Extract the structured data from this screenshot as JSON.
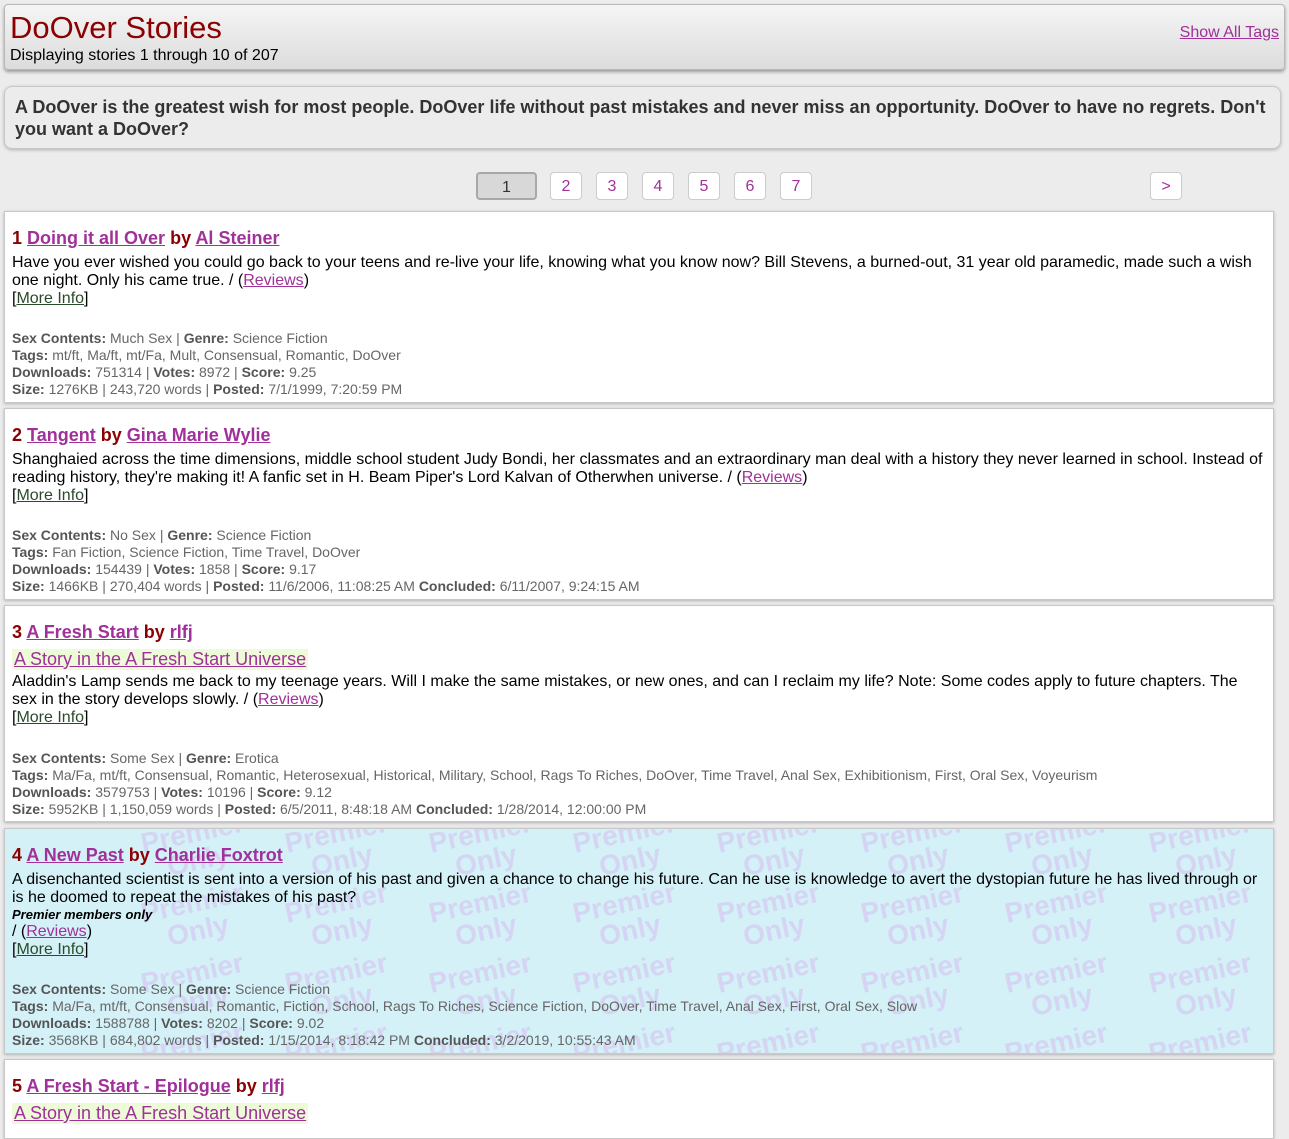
{
  "header": {
    "title": "DoOver Stories",
    "subtitle": "Displaying stories 1 through 10 of 207",
    "show_all_tags": "Show All Tags"
  },
  "intro": "A DoOver is the greatest wish for most people. DoOver life without past mistakes and never miss an opportunity. DoOver to have no regrets. Don't you want a DoOver?",
  "pager": {
    "current": "1",
    "pages": [
      "2",
      "3",
      "4",
      "5",
      "6",
      "7"
    ],
    "next": ">"
  },
  "labels": {
    "by": "by",
    "reviews": "Reviews",
    "more_info": "More Info",
    "sex_contents": "Sex Contents:",
    "genre": "Genre:",
    "tags": "Tags:",
    "downloads": "Downloads:",
    "votes": "Votes:",
    "score": "Score:",
    "size": "Size:",
    "posted": "Posted:",
    "concluded": "Concluded:",
    "premier_only": "Premier members only",
    "watermark_1": "Premier",
    "watermark_2": "Only"
  },
  "stories": [
    {
      "num": "1",
      "title": "Doing it all Over",
      "author": "Al Steiner",
      "desc": "Have you ever wished you could go back to your teens and re-live your life, knowing what you know now? Bill Stevens, a burned-out, 31 year old paramedic, made such a wish one night. Only his came true. / (",
      "sex": "Much Sex",
      "genre": "Science Fiction",
      "tags": "mt/ft, Ma/ft, mt/Fa, Mult, Consensual, Romantic, DoOver",
      "downloads": "751314",
      "votes": "8972",
      "score": "9.25",
      "size": "1276KB | 243,720 words",
      "posted": "7/1/1999, 7:20:59 PM"
    },
    {
      "num": "2",
      "title": "Tangent",
      "author": "Gina Marie Wylie",
      "desc": "Shanghaied across the time dimensions, middle school student Judy Bondi, her classmates and an extraordinary man deal with a history they never learned in school. Instead of reading history, they're making it! A fanfic set in H. Beam Piper's Lord Kalvan of Otherwhen universe. / (",
      "sex": "No Sex",
      "genre": "Science Fiction",
      "tags": "Fan Fiction, Science Fiction, Time Travel, DoOver",
      "downloads": "154439",
      "votes": "1858",
      "score": "9.17",
      "size": "1466KB | 270,404 words",
      "posted": "11/6/2006, 11:08:25 AM",
      "concluded": "6/11/2007, 9:24:15 AM"
    },
    {
      "num": "3",
      "title": "A Fresh Start",
      "author": "rlfj",
      "universe": "A Story in the A Fresh Start Universe",
      "desc": "Aladdin's Lamp sends me back to my teenage years. Will I make the same mistakes, or new ones, and can I reclaim my life? Note: Some codes apply to future chapters. The sex in the story develops slowly. / (",
      "sex": "Some Sex",
      "genre": "Erotica",
      "tags": "Ma/Fa, mt/ft, Consensual, Romantic, Heterosexual, Historical, Military, School, Rags To Riches, DoOver, Time Travel, Anal Sex, Exhibitionism, First, Oral Sex, Voyeurism",
      "downloads": "3579753",
      "votes": "10196",
      "score": "9.12",
      "size": "5952KB | 1,150,059 words",
      "posted": "6/5/2011, 8:48:18 AM",
      "concluded": "1/28/2014, 12:00:00 PM"
    },
    {
      "num": "4",
      "title": "A New Past",
      "author": "Charlie Foxtrot",
      "desc": "A disenchanted scientist is sent into a version of his past and given a chance to change his future. Can he use is knowledge to avert the dystopian future he has lived through or is he doomed to repeat the mistakes of his past?",
      "desc_tail": "/ (",
      "sex": "Some Sex",
      "genre": "Science Fiction",
      "tags": "Ma/Fa, mt/ft, Consensual, Romantic, Fiction, School, Rags To Riches, Science Fiction, DoOver, Time Travel, Anal Sex, First, Oral Sex, Slow",
      "downloads": "1588788",
      "votes": "8202",
      "score": "9.02",
      "size": "3568KB | 684,802 words",
      "posted": "1/15/2014, 8:18:42 PM",
      "concluded": "3/2/2019, 10:55:43 AM"
    },
    {
      "num": "5",
      "title": "A Fresh Start - Epilogue",
      "author": "rlfj",
      "universe": "A Story in the A Fresh Start Universe"
    }
  ]
}
